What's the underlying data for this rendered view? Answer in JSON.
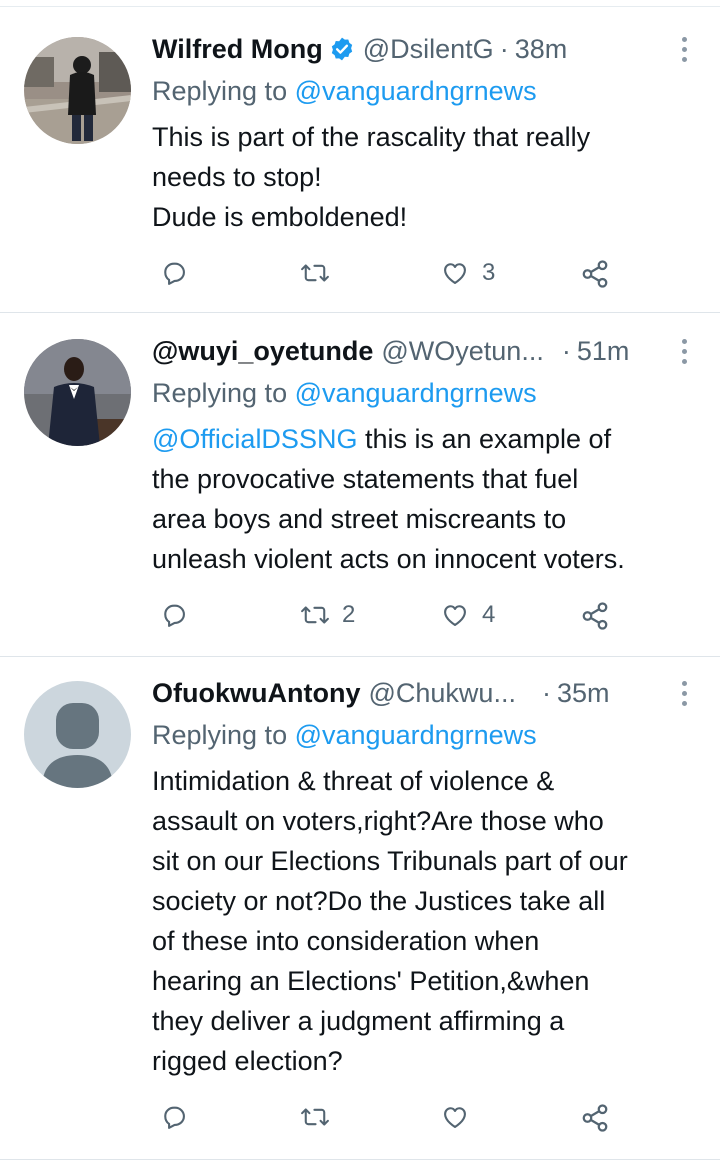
{
  "tweets": [
    {
      "display_name": "Wilfred Mong",
      "verified": true,
      "handle": "@DsilentG",
      "separator": "·",
      "time": "38m",
      "replying_prefix": "Replying to",
      "replying_handle": "@vanguardngrnews",
      "lines": [
        "This is part of the rascality that really",
        "needs to stop!",
        "Dude is emboldened!"
      ],
      "reply_count": "",
      "retweet_count": "",
      "like_count": "3",
      "icons": [
        "reply-icon",
        "retweet-icon",
        "heart-icon",
        "share-icon"
      ]
    },
    {
      "display_name": "@wuyi_oyetunde",
      "verified": false,
      "handle": "@WOyetun...",
      "separator": "·",
      "time": "51m",
      "replying_prefix": "Replying to",
      "replying_handle": "@vanguardngrnews",
      "mention": "@OfficialDSSNG",
      "first_line_rest": " this is an example of",
      "lines": [
        "the provocative statements that fuel",
        "area boys and street miscreants to",
        "unleash violent acts on innocent voters."
      ],
      "reply_count": "",
      "retweet_count": "2",
      "like_count": "4"
    },
    {
      "display_name": "OfuokwuAntony",
      "verified": false,
      "handle": "@Chukwu...",
      "separator": "·",
      "time": "35m",
      "replying_prefix": "Replying to",
      "replying_handle": "@vanguardngrnews",
      "lines": [
        "Intimidation & threat of violence &",
        "assault on voters,right?Are those who",
        "sit on our Elections Tribunals part of our",
        "society or not?Do the Justices take all",
        "of these into consideration when",
        "hearing an Elections' Petition,&when",
        "they deliver a judgment affirming a",
        "rigged election?"
      ],
      "reply_count": "",
      "retweet_count": "",
      "like_count": ""
    }
  ],
  "colors": {
    "accent": "#1d9bf0",
    "secondary_text": "#536471",
    "primary_text": "#0f1419",
    "divider": "#dfe5ea"
  }
}
